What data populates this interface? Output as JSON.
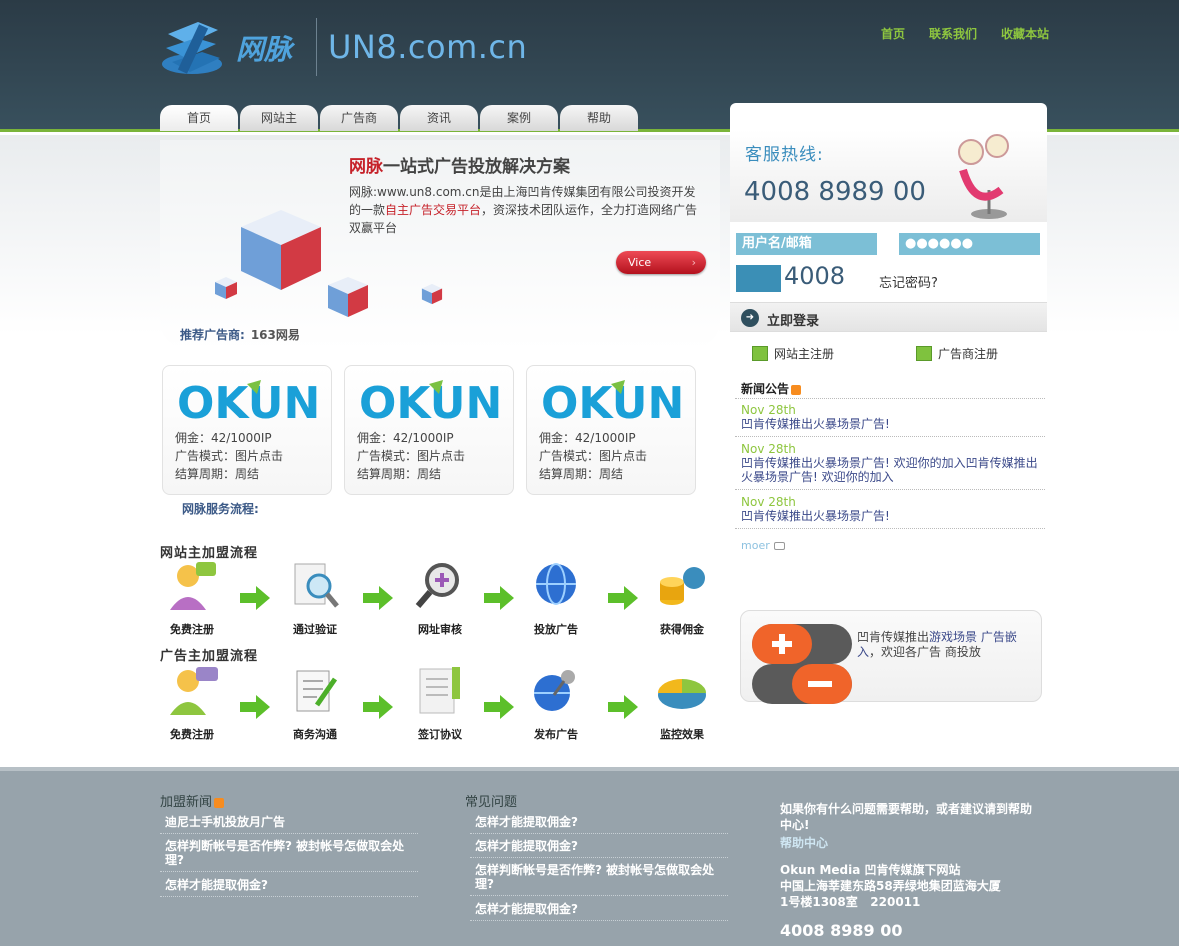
{
  "brand": {
    "logo_cn": "网脉",
    "logo_en": "UN8.com.cn"
  },
  "top_links": [
    "首页",
    "联系我们",
    "收藏本站"
  ],
  "nav_tabs": [
    "首页",
    "网站主",
    "广告商",
    "资讯",
    "案例",
    "帮助"
  ],
  "banner": {
    "title_highlight": "网脉",
    "title_rest": "一站式广告投放解决方案",
    "desc_part1": "网脉:www.un8.com.cn是由上海凹肯传媒集团有限公司投资开发的一款",
    "desc_red": "自主广告交易平台",
    "desc_part2": "，资深技术团队运作，全力打造网络广告双赢平台",
    "button": "Vice"
  },
  "recommend": {
    "label": "推荐广告商:",
    "value": "163网易"
  },
  "ad_cards": [
    {
      "logo": "OKUN",
      "commission": "佣金：42/1000IP",
      "mode": "广告模式：图片点击",
      "cycle": "结算周期：周结"
    },
    {
      "logo": "OKUN",
      "commission": "佣金：42/1000IP",
      "mode": "广告模式：图片点击",
      "cycle": "结算周期：周结"
    },
    {
      "logo": "OKUN",
      "commission": "佣金：42/1000IP",
      "mode": "广告模式：图片点击",
      "cycle": "结算周期：周结"
    }
  ],
  "service_flow_label": "网脉服务流程:",
  "webmaster_flow": {
    "title": "网站主加盟流程",
    "steps": [
      "免费注册",
      "通过验证",
      "网址审核",
      "投放广告",
      "获得佣金"
    ]
  },
  "advertiser_flow": {
    "title": "广告主加盟流程",
    "steps": [
      "免费注册",
      "商务沟通",
      "签订协议",
      "发布广告",
      "监控效果"
    ]
  },
  "sidebar": {
    "hotline_label": "客服热线:",
    "hotline_number": "4008 8989 00",
    "username_placeholder": "用户名/邮箱",
    "password_value": "●●●●●●",
    "captcha_code": "4008",
    "forgot": "忘记密码?",
    "login": "立即登录",
    "reg_webmaster": "网站主注册",
    "reg_advertiser": "广告商注册",
    "news_title": "新闻公告",
    "news": [
      {
        "date": "Nov 28th",
        "title": "凹肯传媒推出火暴场景广告!"
      },
      {
        "date": "Nov 28th",
        "title": "凹肯传媒推出火暴场景广告! 欢迎你的加入凹肯传媒推出火暴场景广告! 欢迎你的加入"
      },
      {
        "date": "Nov 28th",
        "title": "凹肯传媒推出火暴场景广告!"
      }
    ],
    "more": "moer",
    "promo_prefix": "凹肯传媒推出",
    "promo_link": "游戏场景 广告嵌入",
    "promo_suffix": "，欢迎各广告 商投放"
  },
  "footer": {
    "col1_title": "加盟新闻",
    "col1_links": [
      "迪尼士手机投放月广告",
      "怎样判断帐号是否作弊? 被封帐号怎做取会处理?",
      "怎样才能提取佣金?"
    ],
    "col2_title": "常见问题",
    "col2_links": [
      "怎样才能提取佣金?",
      "怎样才能提取佣金?",
      "怎样判断帐号是否作弊? 被封帐号怎做取会处理?",
      "怎样才能提取佣金?"
    ],
    "help_text": "如果你有什么问题需要帮助，或者建议请到帮助中心!",
    "help_link": "帮助中心",
    "company": "Okun Media 凹肯传媒旗下网站",
    "address1": "中国上海莘建东路58弄绿地集团蓝海大厦",
    "address2": "1号楼1308室   220011",
    "phone": "4008 8989 00"
  },
  "colors": {
    "accent_green": "#8ec63f",
    "header_bg": "#2b3b46",
    "link_blue": "#3c4a8a",
    "footer_bg": "#97a3ab"
  }
}
